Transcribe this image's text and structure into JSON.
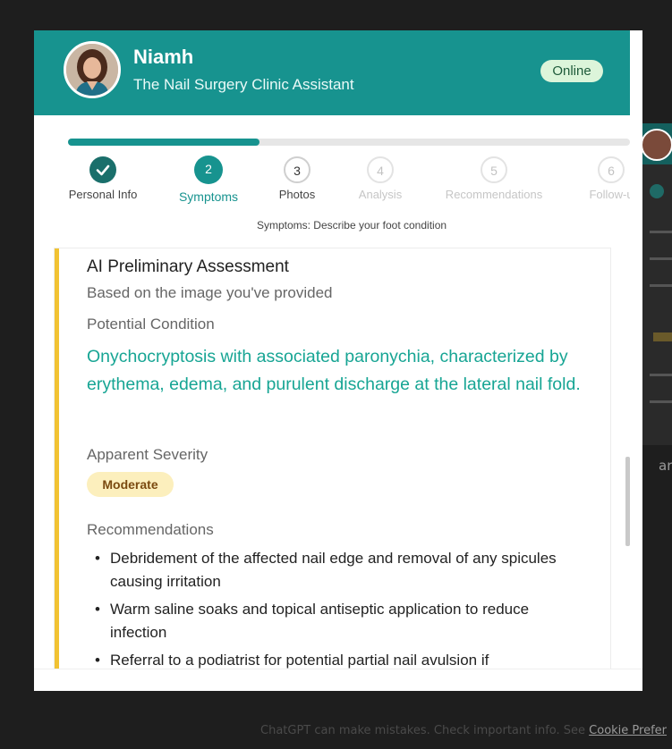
{
  "header": {
    "name": "Niamh",
    "role": "The Nail Surgery Clinic Assistant",
    "status": "Online"
  },
  "progress": {
    "fraction": 0.34
  },
  "steps": [
    {
      "number": "",
      "label": "Personal Info",
      "state": "done"
    },
    {
      "number": "2",
      "label": "Symptoms",
      "state": "active"
    },
    {
      "number": "3",
      "label": "Photos",
      "state": "next"
    },
    {
      "number": "4",
      "label": "Analysis",
      "state": "future"
    },
    {
      "number": "5",
      "label": "Recommendations",
      "state": "future"
    },
    {
      "number": "6",
      "label": "Follow-u",
      "state": "future"
    }
  ],
  "step_description": "Symptoms: Describe your foot condition",
  "assessment": {
    "title": "AI Preliminary Assessment",
    "subtitle": "Based on the image you've provided",
    "condition_heading": "Potential Condition",
    "condition": "Onychocryptosis with associated paronychia, characterized by erythema, edema, and purulent discharge at the lateral nail fold.",
    "severity_heading": "Apparent Severity",
    "severity": "Moderate",
    "recommendations_heading": "Recommendations",
    "recommendations": [
      "Debridement of the affected nail edge and removal of any spicules causing irritation",
      "Warm saline soaks and topical antiseptic application to reduce infection",
      "Referral to a podiatrist for potential partial nail avulsion if"
    ]
  },
  "background_text": "ard",
  "footer": {
    "text": "ChatGPT can make mistakes. Check important info. See ",
    "link": "Cookie Prefer"
  },
  "colors": {
    "brand": "#17938f",
    "accent_bar": "#f1c232",
    "condition_text": "#17a594",
    "badge_bg": "#fcefbd"
  },
  "icons": {
    "step_done": "check-icon",
    "avatar": "assistant-avatar"
  }
}
